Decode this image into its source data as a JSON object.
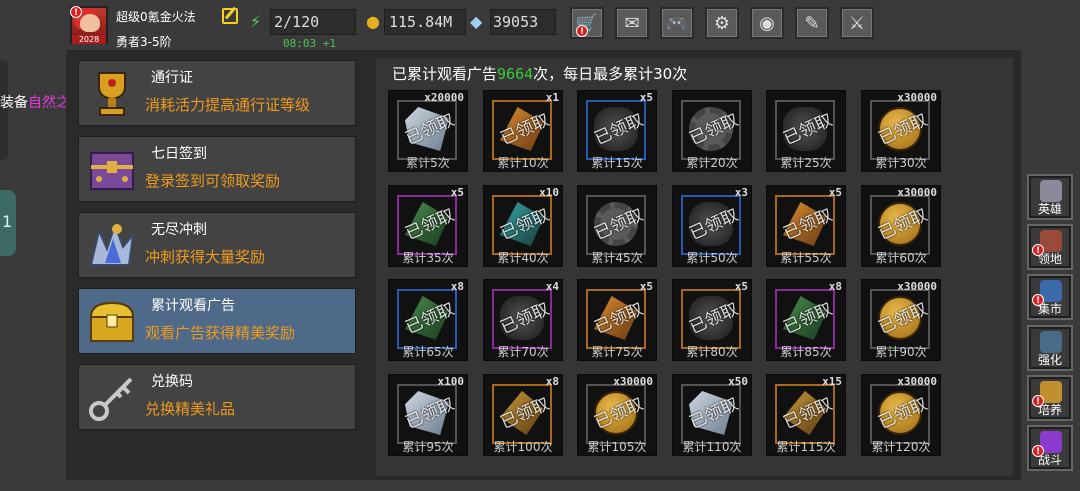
{
  "player": {
    "name": "超级0氪金火法",
    "rank": "勇者3-5阶",
    "avatar_badge": "2028"
  },
  "stats": {
    "energy": "2/120",
    "energy_timer": "08:03 +1",
    "gold": "115.84M",
    "gems": "39053"
  },
  "top_buttons": [
    {
      "icon": "shop-cart-icon",
      "glyph": "🛒",
      "alert": "!"
    },
    {
      "icon": "mail-icon",
      "glyph": "✉"
    },
    {
      "icon": "gamepad-icon",
      "glyph": "🎮"
    },
    {
      "icon": "settings-gear-icon",
      "glyph": "⚙"
    },
    {
      "icon": "color-wheel-icon",
      "glyph": "◉"
    },
    {
      "icon": "feather-icon",
      "glyph": "✎"
    },
    {
      "icon": "crossed-swords-icon",
      "glyph": "⚔"
    }
  ],
  "left_stub": {
    "prefix": "装备",
    "highlight": "自然之触摸",
    "tab_glyph": "1"
  },
  "menu": [
    {
      "title": "通行证",
      "desc": "消耗活力提高通行证等级"
    },
    {
      "title": "七日签到",
      "desc": "登录签到可领取奖励"
    },
    {
      "title": "无尽冲刺",
      "desc": "冲刺获得大量奖励"
    },
    {
      "title": "累计观看广告",
      "desc": "观看广告获得精美奖励"
    },
    {
      "title": "兑换码",
      "desc": "兑换精美礼品"
    }
  ],
  "ad_summary": {
    "prefix": "已累计观看广告",
    "count": "9664",
    "suffix": "次，每日最多累计30次"
  },
  "claimed_label": "已领取",
  "rewards": [
    {
      "qty": "x20000",
      "label": "累计5次",
      "item": "gem-blue",
      "border": "#555"
    },
    {
      "qty": "x1",
      "label": "累计10次",
      "item": "stone-orange",
      "border": "#a86a1a"
    },
    {
      "qty": "x5",
      "label": "累计15次",
      "item": "stone-dark",
      "border": "#2a5ab0"
    },
    {
      "qty": "",
      "label": "累计20次",
      "item": "gear",
      "border": "#555"
    },
    {
      "qty": "",
      "label": "累计25次",
      "item": "stone-dark",
      "border": "#555"
    },
    {
      "qty": "x30000",
      "label": "累计30次",
      "item": "coin",
      "border": "#555"
    },
    {
      "qty": "x5",
      "label": "累计35次",
      "item": "stone-green",
      "border": "#8a2a9a"
    },
    {
      "qty": "x10",
      "label": "累计40次",
      "item": "stone-teal",
      "border": "#a86a1a"
    },
    {
      "qty": "",
      "label": "累计45次",
      "item": "gear",
      "border": "#555"
    },
    {
      "qty": "x3",
      "label": "累计50次",
      "item": "stone-dark",
      "border": "#2a5ab0"
    },
    {
      "qty": "x5",
      "label": "累计55次",
      "item": "stone-orange",
      "border": "#a86a1a"
    },
    {
      "qty": "x30000",
      "label": "累计60次",
      "item": "coin",
      "border": "#555"
    },
    {
      "qty": "x8",
      "label": "累计65次",
      "item": "stone-green",
      "border": "#2a5ab0"
    },
    {
      "qty": "x4",
      "label": "累计70次",
      "item": "stone-dark",
      "border": "#8a2a9a"
    },
    {
      "qty": "x5",
      "label": "累计75次",
      "item": "stone-orange",
      "border": "#a86a1a"
    },
    {
      "qty": "x5",
      "label": "累计80次",
      "item": "stone-dark",
      "border": "#a86a1a"
    },
    {
      "qty": "x8",
      "label": "累计85次",
      "item": "stone-green",
      "border": "#8a2a9a"
    },
    {
      "qty": "x30000",
      "label": "累计90次",
      "item": "coin",
      "border": "#555"
    },
    {
      "qty": "x100",
      "label": "累计95次",
      "item": "gem-blue",
      "border": "#555"
    },
    {
      "qty": "x8",
      "label": "累计100次",
      "item": "stone-brown",
      "border": "#a86a1a"
    },
    {
      "qty": "x30000",
      "label": "累计105次",
      "item": "coin",
      "border": "#555"
    },
    {
      "qty": "x50",
      "label": "累计110次",
      "item": "gem-blue",
      "border": "#555"
    },
    {
      "qty": "x15",
      "label": "累计115次",
      "item": "stone-brown",
      "border": "#a86a1a"
    },
    {
      "qty": "x30000",
      "label": "累计120次",
      "item": "coin",
      "border": "#555"
    }
  ],
  "side_nav": [
    {
      "label": "英雄",
      "icon": "hero-helmet-icon",
      "color": "#8a8a9a",
      "alert": false
    },
    {
      "label": "领地",
      "icon": "territory-castle-icon",
      "color": "#9a4a3a",
      "alert": true
    },
    {
      "label": "集市",
      "icon": "market-stall-icon",
      "color": "#3a6aaa",
      "alert": true
    },
    {
      "label": "强化",
      "icon": "enhance-shield-icon",
      "color": "#4a6a8a",
      "alert": false
    },
    {
      "label": "培养",
      "icon": "training-flask-icon",
      "color": "#c09030",
      "alert": true
    },
    {
      "label": "战斗",
      "icon": "battle-portal-icon",
      "color": "#8a3acc",
      "alert": true
    }
  ],
  "alert_glyph": "!"
}
